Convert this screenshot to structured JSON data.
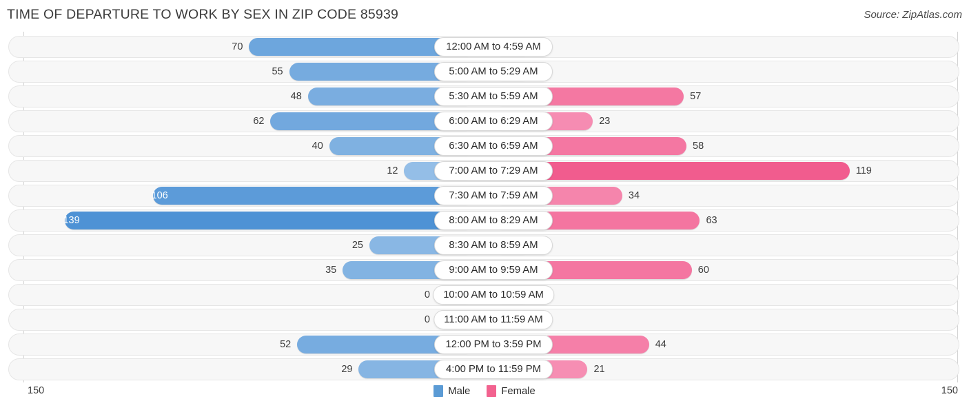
{
  "header": {
    "title": "TIME OF DEPARTURE TO WORK BY SEX IN ZIP CODE 85939",
    "source": "Source: ZipAtlas.com"
  },
  "legend": {
    "male_label": "Male",
    "female_label": "Female",
    "male_color": "#5b9bd5",
    "female_color": "#f2628f"
  },
  "axis": {
    "left_max": "150",
    "right_max": "150"
  },
  "chart_data": {
    "type": "bar",
    "title": "TIME OF DEPARTURE TO WORK BY SEX IN ZIP CODE 85939",
    "subtitle": "Source: ZipAtlas.com",
    "orientation": "horizontal-diverging",
    "xlabel": "",
    "ylabel": "",
    "xlim": [
      150,
      150
    ],
    "grid": false,
    "legend_position": "bottom-center",
    "categories": [
      "12:00 AM to 4:59 AM",
      "5:00 AM to 5:29 AM",
      "5:30 AM to 5:59 AM",
      "6:00 AM to 6:29 AM",
      "6:30 AM to 6:59 AM",
      "7:00 AM to 7:29 AM",
      "7:30 AM to 7:59 AM",
      "8:00 AM to 8:29 AM",
      "8:30 AM to 8:59 AM",
      "9:00 AM to 9:59 AM",
      "10:00 AM to 10:59 AM",
      "11:00 AM to 11:59 AM",
      "12:00 PM to 3:59 PM",
      "4:00 PM to 11:59 PM"
    ],
    "series": [
      {
        "name": "Male",
        "color": "#5b9bd5",
        "values": [
          70,
          55,
          48,
          62,
          40,
          12,
          106,
          139,
          25,
          35,
          0,
          0,
          52,
          29
        ]
      },
      {
        "name": "Female",
        "color": "#f2628f",
        "values": [
          0,
          0,
          57,
          23,
          58,
          119,
          34,
          63,
          0,
          60,
          0,
          0,
          44,
          21
        ]
      }
    ]
  }
}
